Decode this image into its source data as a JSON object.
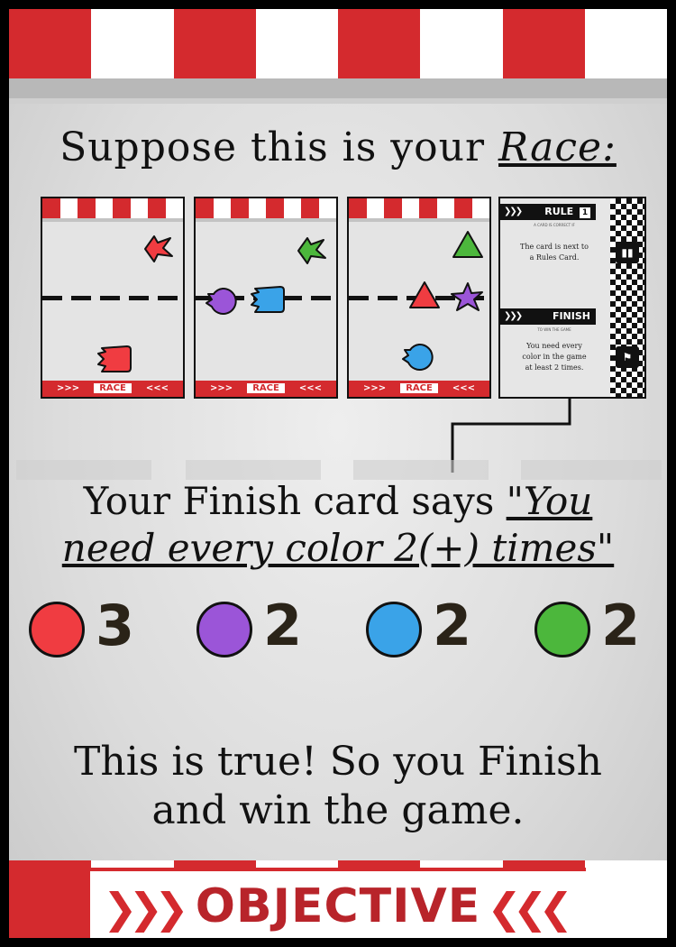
{
  "title": {
    "prefix": "Suppose this is your",
    "race_word": "Race:"
  },
  "race_cards": [
    {
      "label": "RACE",
      "shapes": [
        {
          "color": "red",
          "shape": "flag"
        },
        {
          "color": "red",
          "shape": "square"
        }
      ]
    },
    {
      "label": "RACE",
      "shapes": [
        {
          "color": "green",
          "shape": "flag"
        },
        {
          "color": "purple",
          "shape": "circle"
        },
        {
          "color": "blue",
          "shape": "square"
        }
      ]
    },
    {
      "label": "RACE",
      "shapes": [
        {
          "color": "green",
          "shape": "triangle"
        },
        {
          "color": "red",
          "shape": "triangle"
        },
        {
          "color": "purple",
          "shape": "star"
        },
        {
          "color": "blue",
          "shape": "circle"
        }
      ]
    }
  ],
  "rule_card": {
    "rule_label": "RULE",
    "rule_number": "1",
    "rule_subtitle": "A CARD IS CORRECT IF",
    "rule_text_line1": "The card is next to",
    "rule_text_line2": "a Rules Card.",
    "finish_label": "FINISH",
    "finish_subtitle": "TO WIN THE GAME",
    "finish_text_line1": "You need every",
    "finish_text_line2": "color in the game",
    "finish_text_line3": "at least 2 times."
  },
  "finish_statement": {
    "line1_prefix": "Your Finish card says",
    "quote_line1": "\"You",
    "quote_line2": "need every color 2(+) times\""
  },
  "color_counts": [
    {
      "color": "#f03c41",
      "name": "red",
      "count": "3"
    },
    {
      "color": "#9b55d8",
      "name": "purple",
      "count": "2"
    },
    {
      "color": "#3aa3e8",
      "name": "blue",
      "count": "2"
    },
    {
      "color": "#4cb73c",
      "name": "green",
      "count": "2"
    }
  ],
  "conclusion": {
    "line1": "This is true! So you Finish",
    "line2": "and win the game."
  },
  "banner": {
    "label": "OBJECTIVE"
  },
  "colors": {
    "red": "#f03c41",
    "purple": "#9b55d8",
    "blue": "#3aa3e8",
    "green": "#4cb73c",
    "stripe_red": "#d42a2e"
  }
}
